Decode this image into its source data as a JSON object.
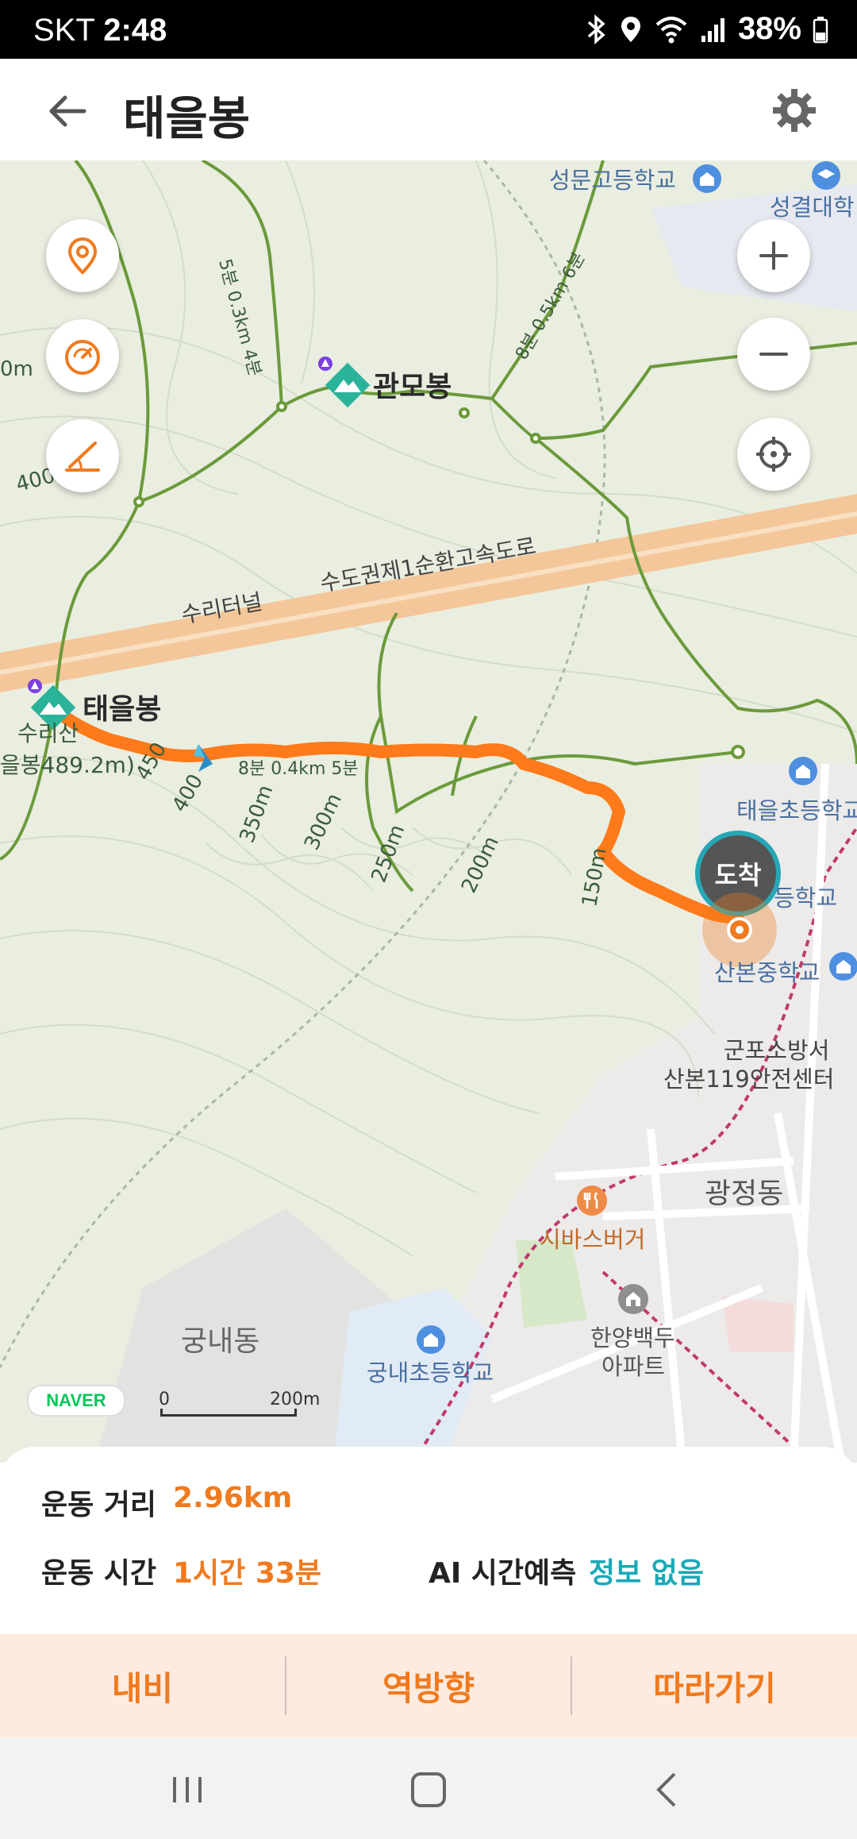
{
  "status_bar": {
    "carrier": "SKT",
    "time": "2:48",
    "battery": "38%"
  },
  "header": {
    "title": "태을봉",
    "back_icon": "arrow-left-icon",
    "settings_icon": "gear-icon"
  },
  "map": {
    "labels": {
      "school_seongmun": "성문고등학교",
      "seonggyeol": "성결대학",
      "gwanmobong": "관모봉",
      "taeeulbong": "태을봉",
      "suri_tunnel": "수리터널",
      "expressway": "수도권제1순환고속도로",
      "taeeul_elem": "태을초등학교",
      "middle_high": "등학교",
      "sanbon_middle": "산본중학교",
      "fire_station": "군포소방서",
      "rescue_center": "산본119안전센터",
      "gwangjeong": "광정동",
      "sibas": "시바스버거",
      "hanyang": "한양백두",
      "apartment": "아파트",
      "gungnae_dong": "궁내동",
      "gungnae_elem": "궁내초등학교",
      "suri_san": "수리산",
      "summit_height": "을봉489.2m)",
      "trail_a": "5분 0.3km 4분",
      "trail_b": "8분 0.5km 6분",
      "trail_c": "8분 0.4km 5분",
      "arrival": "도착",
      "c400a": "400",
      "c400b": "400",
      "c450": "450",
      "c350": "350m",
      "c300": "300m",
      "c250": "250m",
      "c200": "200m",
      "c150": "150m",
      "c0m": "0m"
    },
    "naver_logo": "NAVER",
    "scale_zero": "0",
    "scale_label": "200m"
  },
  "stats": {
    "distance_label": "운동 거리",
    "distance_value": "2.96km",
    "time_label": "운동 시간",
    "time_value": "1시간 33분",
    "ai_label": "AI 시간예측",
    "ai_value": "정보 없음"
  },
  "actions": {
    "navi": "내비",
    "reverse": "역방향",
    "follow": "따라가기"
  },
  "colors": {
    "accent": "#f07a1e",
    "teal": "#19a9b7",
    "route": "#ff7a1a"
  }
}
